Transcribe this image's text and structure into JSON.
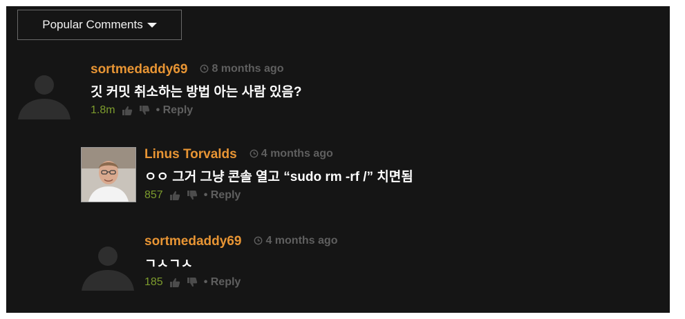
{
  "sort": {
    "label": "Popular Comments"
  },
  "comments": [
    {
      "username": "sortmedaddy69",
      "time": "8 months ago",
      "text": "깃 커밋 취소하는 방법 아는 사람 있음?",
      "votes": "1.8m",
      "reply": "• Reply",
      "avatar": "default-avatar"
    },
    {
      "username": "Linus Torvalds",
      "time": "4 months ago",
      "text": "ㅇㅇ 그거 그냥 콘솔 열고 “sudo rm -rf /” 치면됨",
      "votes": "857",
      "reply": "• Reply",
      "avatar": "profile-photo"
    },
    {
      "username": "sortmedaddy69",
      "time": "4 months ago",
      "text": "ㄱㅅㄱㅅ",
      "votes": "185",
      "reply": "• Reply",
      "avatar": "default-avatar"
    }
  ],
  "colors": {
    "background": "#151515",
    "username": "#e89534",
    "votes": "#7d9c2d",
    "muted": "#5f5f5f",
    "text": "#ffffff"
  }
}
